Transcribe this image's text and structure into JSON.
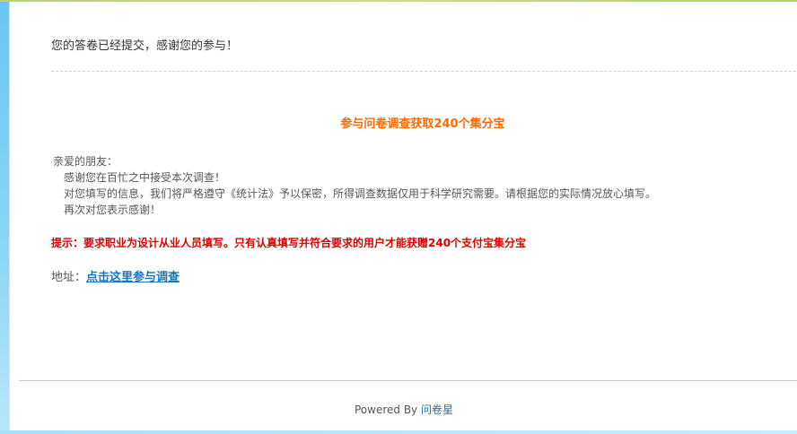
{
  "page": {
    "submitted_message": "您的答卷已经提交，感谢您的参与！",
    "campaign_title": "参与问卷调查获取240个集分宝",
    "letter": {
      "greeting": "亲爱的朋友：",
      "line1": "感谢您在百忙之中接受本次调查！",
      "line2": "对您填写的信息，我们将严格遵守《统计法》予以保密，所得调查数据仅用于科学研究需要。请根据您的实际情况放心填写。",
      "line3": "再次对您表示感谢！"
    },
    "notice": "提示：要求职业为设计从业人员填写。只有认真填写并符合要求的用户才能获赠240个支付宝集分宝",
    "address_label": "地址：",
    "address_link_text": "点击这里参与调查"
  },
  "footer": {
    "powered_by_label": "Powered By",
    "brand_link": "问卷星"
  },
  "colors": {
    "campaign_title": "#ff6a00",
    "notice": "#e00000",
    "link": "#1a73c1",
    "background_left": "#69c5f2"
  }
}
